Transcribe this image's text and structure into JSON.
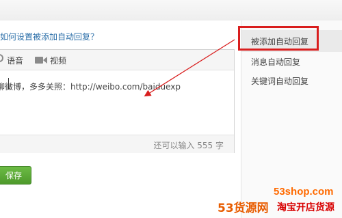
{
  "help": {
    "link_text": "如何设置被添加自动回复？"
  },
  "editor": {
    "toolbar": {
      "voice_label": "语音",
      "video_label": "视频"
    },
    "content": "聊微博，多多关照：http://weibo.com/baiduexp",
    "counter_text": "还可以输入 555 字"
  },
  "actions": {
    "save_label": "保存"
  },
  "sidebar": {
    "items": [
      {
        "label": "被添加自动回复",
        "active": true
      },
      {
        "label": "消息自动回复",
        "active": false
      },
      {
        "label": "关键词自动回复",
        "active": false
      }
    ]
  },
  "annotation": {
    "highlight_color": "#d91e1e"
  },
  "watermark": {
    "url": "53shop.com",
    "brand": "53货源网",
    "slogan": "淘宝开店货源"
  }
}
